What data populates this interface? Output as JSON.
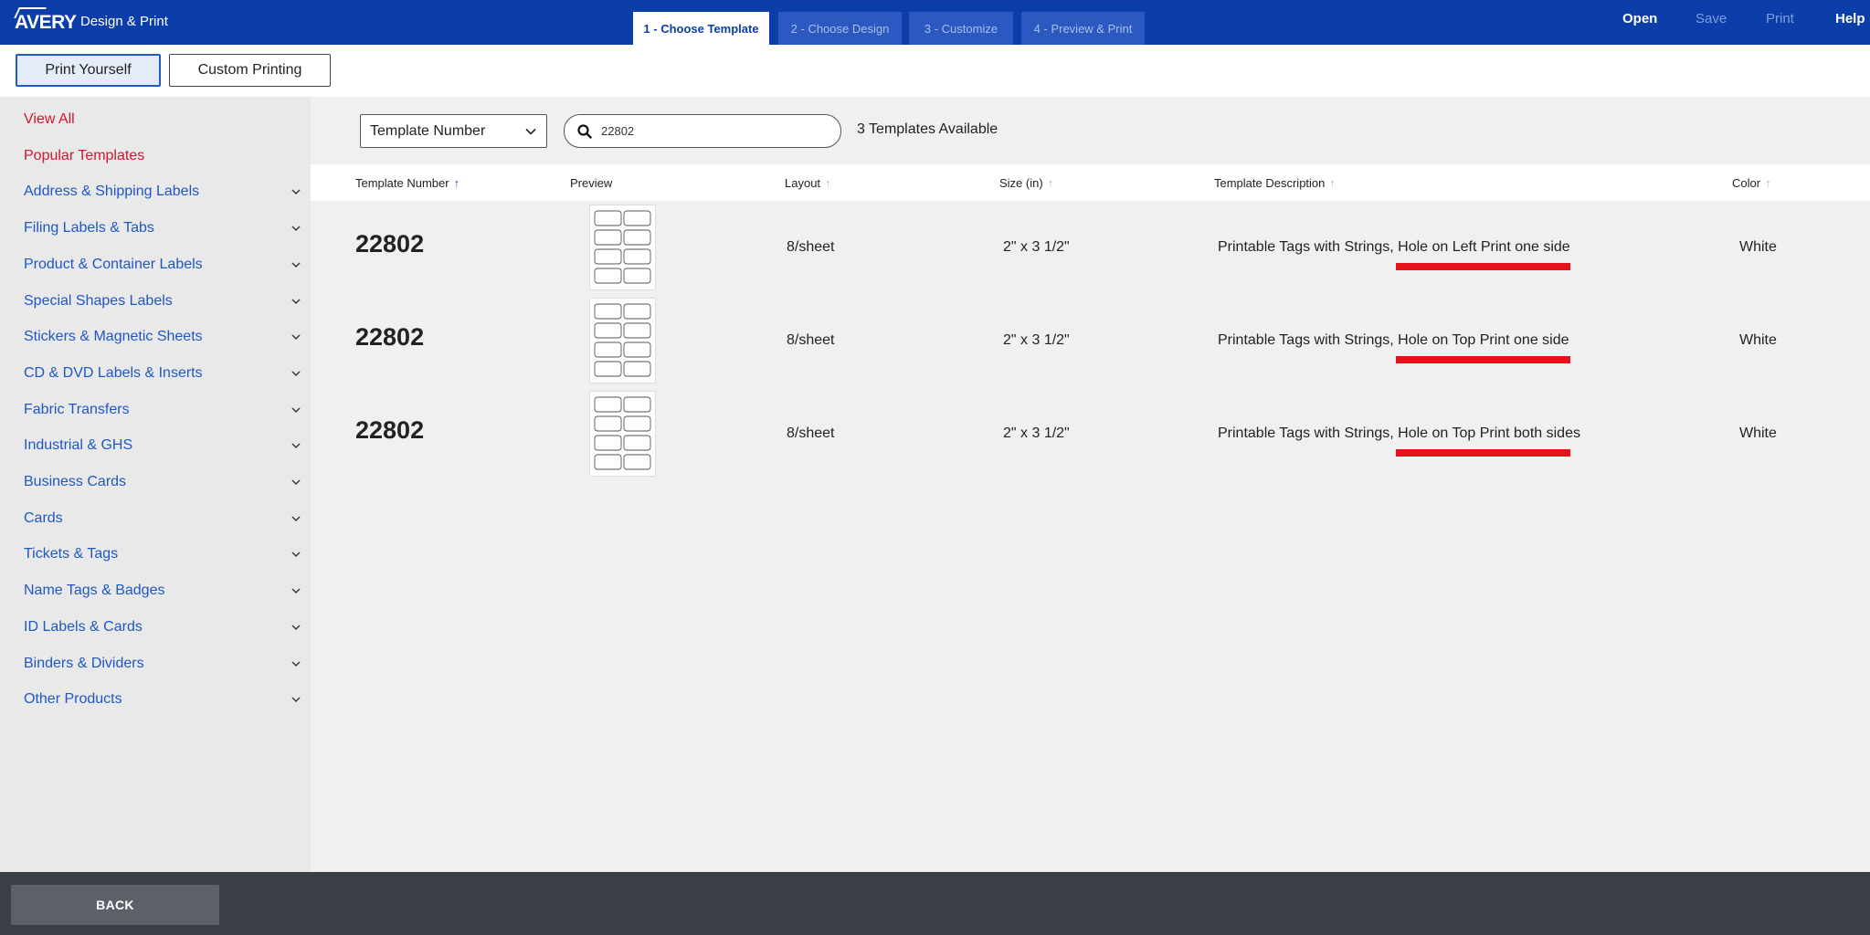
{
  "app": {
    "logo_text": "AVERY",
    "title": "Design & Print"
  },
  "steps": [
    {
      "label": "1 - Choose Template",
      "active": true
    },
    {
      "label": "2 - Choose Design",
      "active": false
    },
    {
      "label": "3 - Customize",
      "active": false
    },
    {
      "label": "4 - Preview & Print",
      "active": false
    }
  ],
  "top_actions": {
    "open": "Open",
    "save": "Save",
    "print": "Print",
    "help": "Help"
  },
  "modes": {
    "print_yourself": "Print Yourself",
    "custom_printing": "Custom Printing"
  },
  "sidebar": {
    "items": [
      {
        "label": "View All",
        "expandable": false
      },
      {
        "label": "Popular Templates",
        "expandable": false
      },
      {
        "label": "Address & Shipping Labels",
        "expandable": true
      },
      {
        "label": "Filing Labels & Tabs",
        "expandable": true
      },
      {
        "label": "Product & Container Labels",
        "expandable": true
      },
      {
        "label": "Special Shapes Labels",
        "expandable": true
      },
      {
        "label": "Stickers & Magnetic Sheets",
        "expandable": true
      },
      {
        "label": "CD & DVD Labels & Inserts",
        "expandable": true
      },
      {
        "label": "Fabric Transfers",
        "expandable": true
      },
      {
        "label": "Industrial & GHS",
        "expandable": true
      },
      {
        "label": "Business Cards",
        "expandable": true
      },
      {
        "label": "Cards",
        "expandable": true
      },
      {
        "label": "Tickets & Tags",
        "expandable": true
      },
      {
        "label": "Name Tags & Badges",
        "expandable": true
      },
      {
        "label": "ID Labels & Cards",
        "expandable": true
      },
      {
        "label": "Binders & Dividers",
        "expandable": true
      },
      {
        "label": "Other Products",
        "expandable": true
      }
    ]
  },
  "filter": {
    "selected": "Template Number"
  },
  "search": {
    "value": "22802"
  },
  "results_count": "3 Templates Available",
  "table": {
    "headers": {
      "template_number": "Template Number",
      "preview": "Preview",
      "layout": "Layout",
      "size": "Size (in)",
      "description": "Template Description",
      "color": "Color"
    },
    "rows": [
      {
        "template_number": "22802",
        "layout": "8/sheet",
        "size": "2\" x 3 1/2\"",
        "description_prefix": "Printable Tags with Strings, ",
        "description_highlight": "Hole on Left Print one side",
        "color": "White"
      },
      {
        "template_number": "22802",
        "layout": "8/sheet",
        "size": "2\" x 3 1/2\"",
        "description_prefix": "Printable Tags with Strings, ",
        "description_highlight": "Hole on Top Print one side",
        "color": "White"
      },
      {
        "template_number": "22802",
        "layout": "8/sheet",
        "size": "2\" x 3 1/2\"",
        "description_prefix": "Printable Tags with Strings, ",
        "description_highlight": "Hole on Top Print both sides",
        "color": "White"
      }
    ]
  },
  "footer": {
    "back": "BACK"
  },
  "colors": {
    "brand_blue": "#0b3ea8",
    "link_blue": "#1f57c3",
    "link_red": "#d5142d",
    "highlight_red": "#e5121b"
  }
}
